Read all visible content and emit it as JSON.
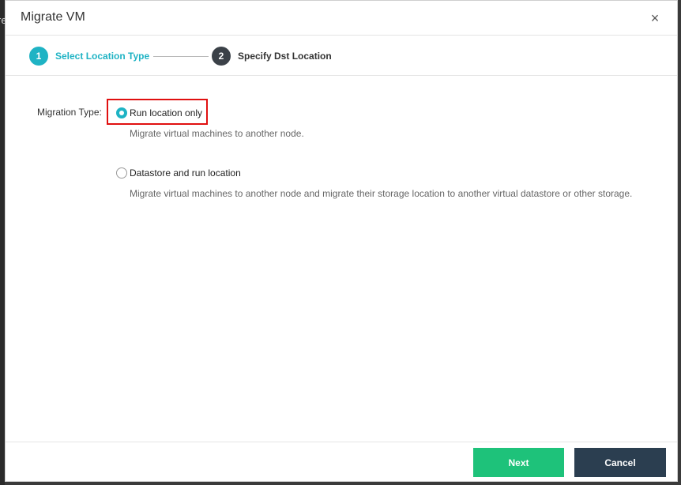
{
  "backdrop": {
    "glyph": "re"
  },
  "dialog": {
    "title": "Migrate VM",
    "close_icon": "×"
  },
  "steps": [
    {
      "number": "1",
      "label": "Select Location Type",
      "state": "active"
    },
    {
      "number": "2",
      "label": "Specify Dst Location",
      "state": "inactive"
    }
  ],
  "form": {
    "migration_type_label": "Migration Type:",
    "options": [
      {
        "label": "Run location only",
        "description": "Migrate virtual machines to another node.",
        "selected": true
      },
      {
        "label": "Datastore and run location",
        "description": "Migrate virtual machines to another node and migrate their storage location to another virtual datastore or other storage.",
        "selected": false
      }
    ]
  },
  "footer": {
    "next_label": "Next",
    "cancel_label": "Cancel"
  },
  "colors": {
    "accent": "#1fb3c4",
    "next_button": "#1ec27a",
    "cancel_button": "#2b3e50",
    "highlight_box": "#e01010"
  }
}
